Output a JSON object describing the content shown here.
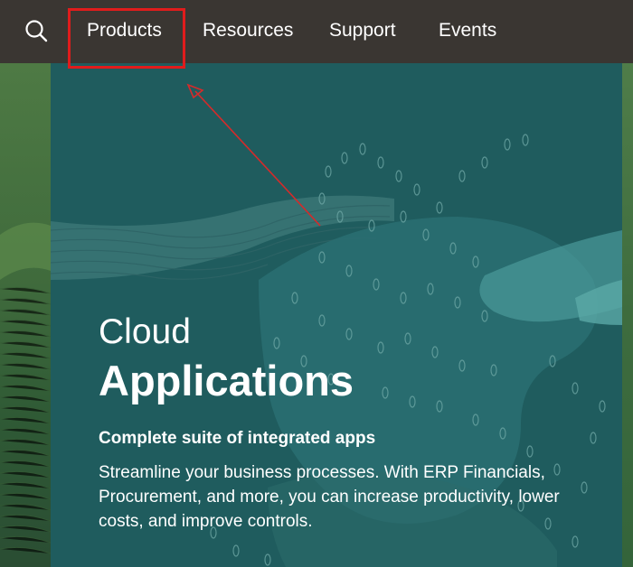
{
  "nav": {
    "search_icon": "search-icon",
    "items": [
      {
        "label": "Products"
      },
      {
        "label": "Resources"
      },
      {
        "label": "Support"
      },
      {
        "label": "Events"
      }
    ]
  },
  "hero": {
    "title_light": "Cloud",
    "title_bold": "Applications",
    "subtitle": "Complete suite of integrated apps",
    "description": "Streamline your business processes. With ERP Financials, Procurement, and more, you can increase productivity, lower costs, and improve controls."
  },
  "annotation": {
    "color": "#e01c1c"
  },
  "colors": {
    "nav_bg": "#3a3632",
    "hero_bg": "#1f5c5e",
    "text": "#ffffff"
  }
}
